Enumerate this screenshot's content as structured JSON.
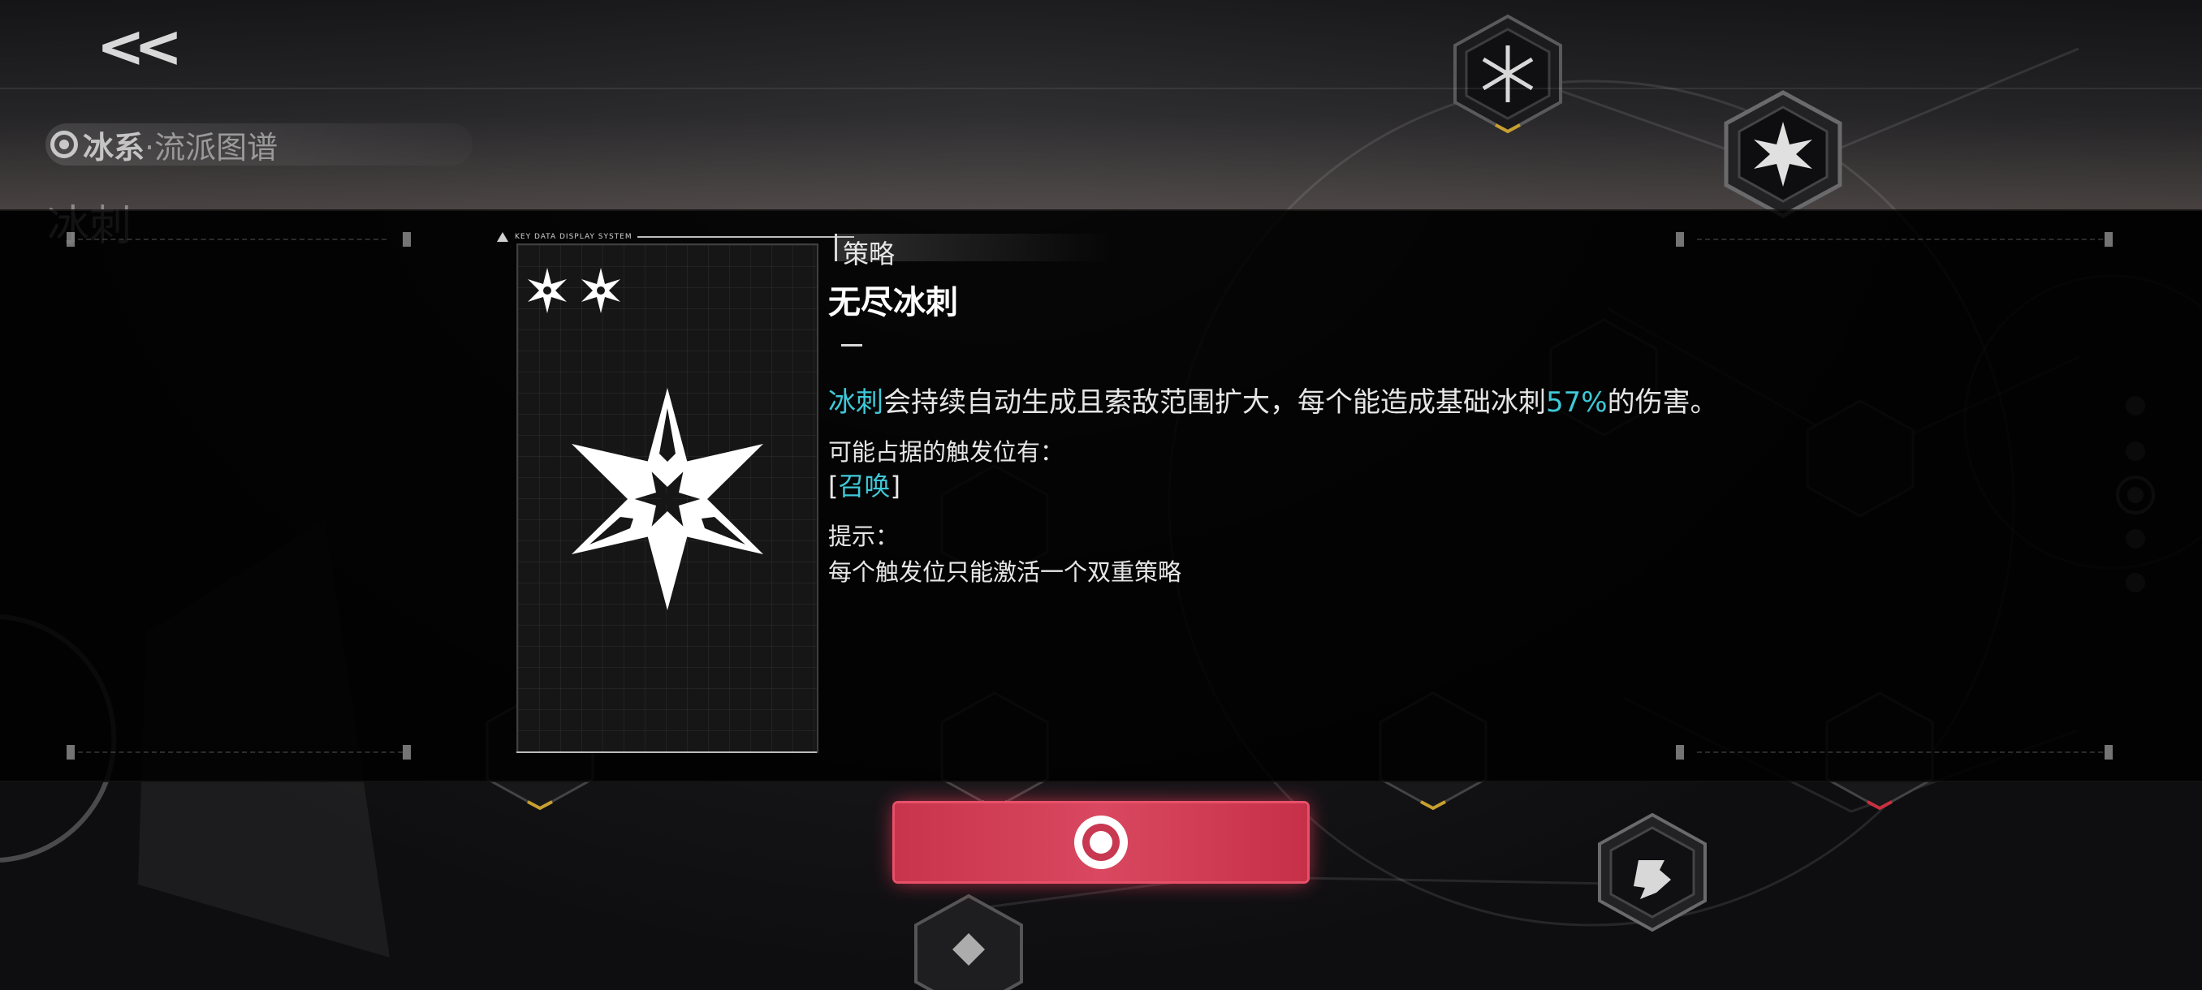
{
  "header": {
    "back_label": "<<",
    "breadcrumb_main": "冰系",
    "breadcrumb_sub": "·流派图谱",
    "category": "冰刺"
  },
  "card": {
    "header_text": "KEY DATA DISPLAY SYSTEM",
    "rarity_stars": 2,
    "icon": "ice-star-icon"
  },
  "detail": {
    "type_label": "策略",
    "name": "无尽冰刺",
    "dash": "—",
    "desc_highlight_1": "冰刺",
    "desc_mid": "会持续自动生成且索敌范围扩大，每个能造成基础冰刺",
    "desc_highlight_2": "57%",
    "desc_end": "的伤害。",
    "trigger_label": "可能占据的触发位有：",
    "trigger_open": "[",
    "trigger_value": "召唤",
    "trigger_close": "]",
    "hint_label": "提示：",
    "hint_text": "每个触发位只能激活一个双重策略"
  },
  "confirm_button": {
    "icon": "target-icon"
  },
  "colors": {
    "accent_cyan": "#3fc9d8",
    "confirm_red": "#d94860",
    "node_gold": "#c8a030",
    "node_red": "#c83040"
  }
}
